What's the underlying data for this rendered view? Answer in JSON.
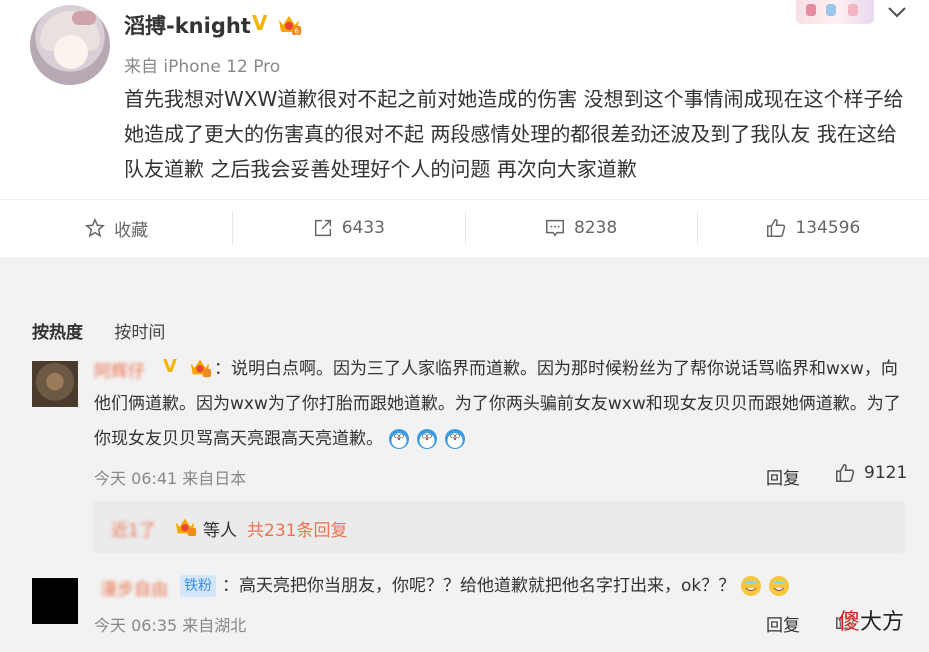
{
  "post": {
    "username": "滔搏-knight",
    "source": "来自 iPhone 12 Pro",
    "text": "首先我想对WXW道歉很对不起之前对她造成的伤害 没想到这个事情闹成现在这个样子给她造成了更大的伤害真的很对不起 两段感情处理的都很差劲还波及到了我队友 我在这给队友道歉 之后我会妥善处理好个人的问题 再次向大家道歉",
    "verified_icon": "V",
    "actions": {
      "favorite_label": "收藏",
      "repost_count": "6433",
      "comment_count": "8238",
      "like_count": "134596"
    }
  },
  "sort": {
    "by_hot": "按热度",
    "by_time": "按时间"
  },
  "comments": [
    {
      "name": "阿辉仔",
      "text": "：说明白点啊。因为三了人家临界而道歉。因为那时候粉丝为了帮你说话骂临界和wxw，向他们俩道歉。因为wxw为了你打胎而跟她道歉。为了你两头骗前女友wxw和现女友贝贝而跟她俩道歉。为了你现女友贝贝骂高天亮跟高天亮道歉。",
      "meta": "今天 06:41 来自日本",
      "reply_label": "回复",
      "like_count": "9121",
      "sub_replies": {
        "name": "近1了",
        "suffix": "等人",
        "count_text": "共231条回复"
      }
    },
    {
      "name": "漫步自由",
      "badge": "铁粉",
      "text": "：高天亮把你当朋友，你呢？？给他道歉就把他名字打出来，ok？？",
      "meta": "今天 06:35 来自湖北",
      "reply_label": "回复"
    }
  ],
  "watermark": {
    "red_part": "傻",
    "black_part": "大方"
  },
  "colors": {
    "accent_orange": "#eb7350",
    "verified_gold": "#f5b400",
    "background": "#f2f2f2"
  }
}
